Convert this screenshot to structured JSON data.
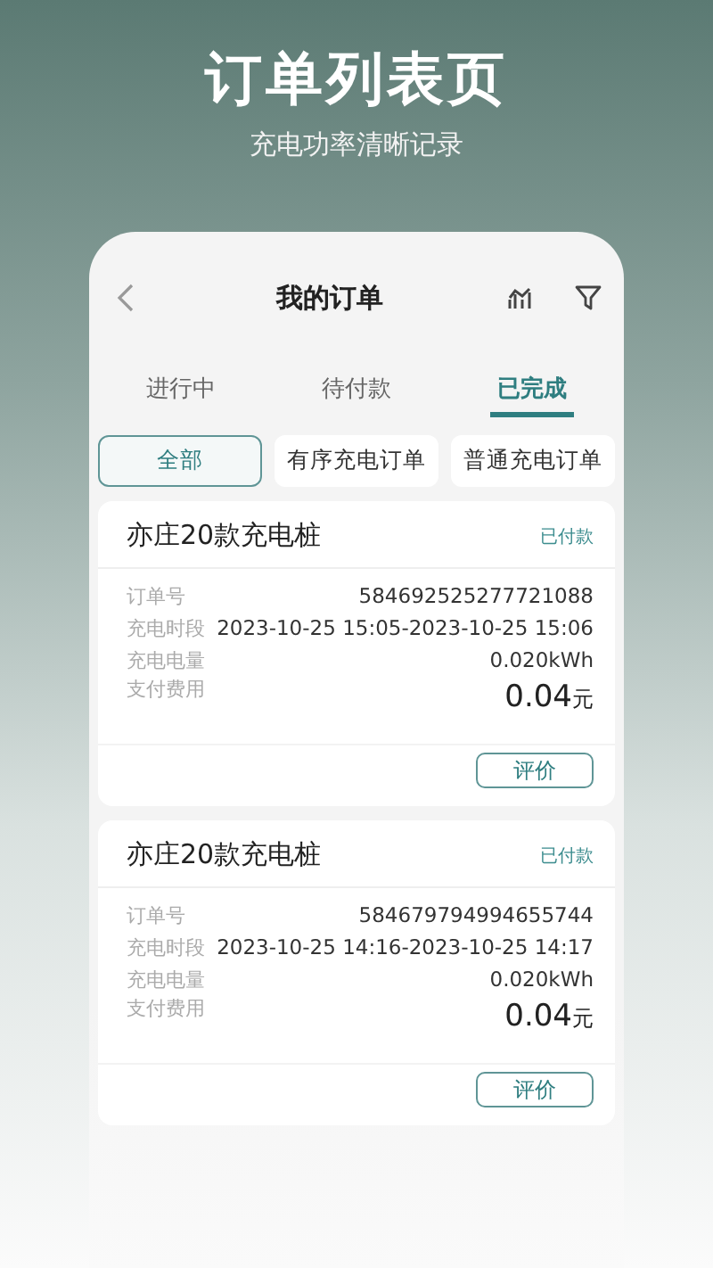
{
  "headline": "订单列表页",
  "subheadline": "充电功率清晰记录",
  "nav": {
    "title": "我的订单"
  },
  "tabs": [
    {
      "label": "进行中",
      "selected": false
    },
    {
      "label": "待付款",
      "selected": false
    },
    {
      "label": "已完成",
      "selected": true
    }
  ],
  "filters": [
    {
      "label": "全部",
      "selected": true
    },
    {
      "label": "有序充电订单",
      "selected": false
    },
    {
      "label": "普通充电订单",
      "selected": false
    }
  ],
  "orders": [
    {
      "station": "亦庄20款充电桩",
      "status": "已付款",
      "fields": [
        {
          "label": "订单号",
          "value": "584692525277721088"
        },
        {
          "label": "充电时段",
          "value": "2023-10-25 15:05-2023-10-25 15:06"
        },
        {
          "label": "充电电量",
          "value": "0.020kWh"
        }
      ],
      "fee_label": "支付费用",
      "amount": "0.04",
      "unit": "元",
      "action": "评价"
    },
    {
      "station": "亦庄20款充电桩",
      "status": "已付款",
      "fields": [
        {
          "label": "订单号",
          "value": "584679794994655744"
        },
        {
          "label": "充电时段",
          "value": "2023-10-25 14:16-2023-10-25 14:17"
        },
        {
          "label": "充电电量",
          "value": "0.020kWh"
        }
      ],
      "fee_label": "支付费用",
      "amount": "0.04",
      "unit": "元",
      "action": "评价"
    }
  ]
}
